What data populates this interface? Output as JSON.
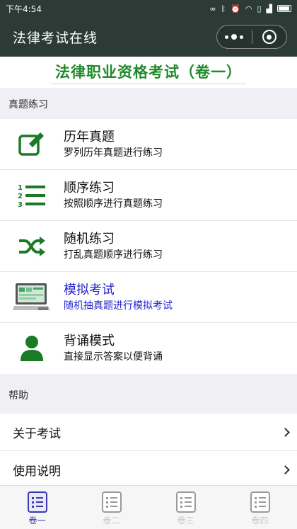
{
  "status": {
    "time": "下午4:54"
  },
  "app": {
    "title": "法律考试在线"
  },
  "exam_title": "法律职业资格考试（卷一）",
  "sections": {
    "practice": "真题练习",
    "help": "帮助"
  },
  "practice_items": [
    {
      "title": "历年真题",
      "subtitle": "罗列历年真题进行练习",
      "icon": "edit-icon",
      "active": false
    },
    {
      "title": "顺序练习",
      "subtitle": "按照顺序进行真题练习",
      "icon": "numbered-list-icon",
      "active": false
    },
    {
      "title": "随机练习",
      "subtitle": "打乱真题顺序进行练习",
      "icon": "shuffle-icon",
      "active": false
    },
    {
      "title": "模拟考试",
      "subtitle": "随机抽真题进行模拟考试",
      "icon": "computer-icon",
      "active": true
    },
    {
      "title": "背诵模式",
      "subtitle": "直接显示答案以便背诵",
      "icon": "user-icon",
      "active": false
    }
  ],
  "help_items": [
    {
      "label": "关于考试"
    },
    {
      "label": "使用说明"
    }
  ],
  "tabs": [
    {
      "label": "卷一",
      "active": true
    },
    {
      "label": "卷二",
      "active": false
    },
    {
      "label": "卷三",
      "active": false
    },
    {
      "label": "卷四",
      "active": false
    }
  ],
  "colors": {
    "nav_bg": "#2c3b35",
    "accent_green": "#1f8a2a",
    "active_blue": "#2222cc"
  }
}
